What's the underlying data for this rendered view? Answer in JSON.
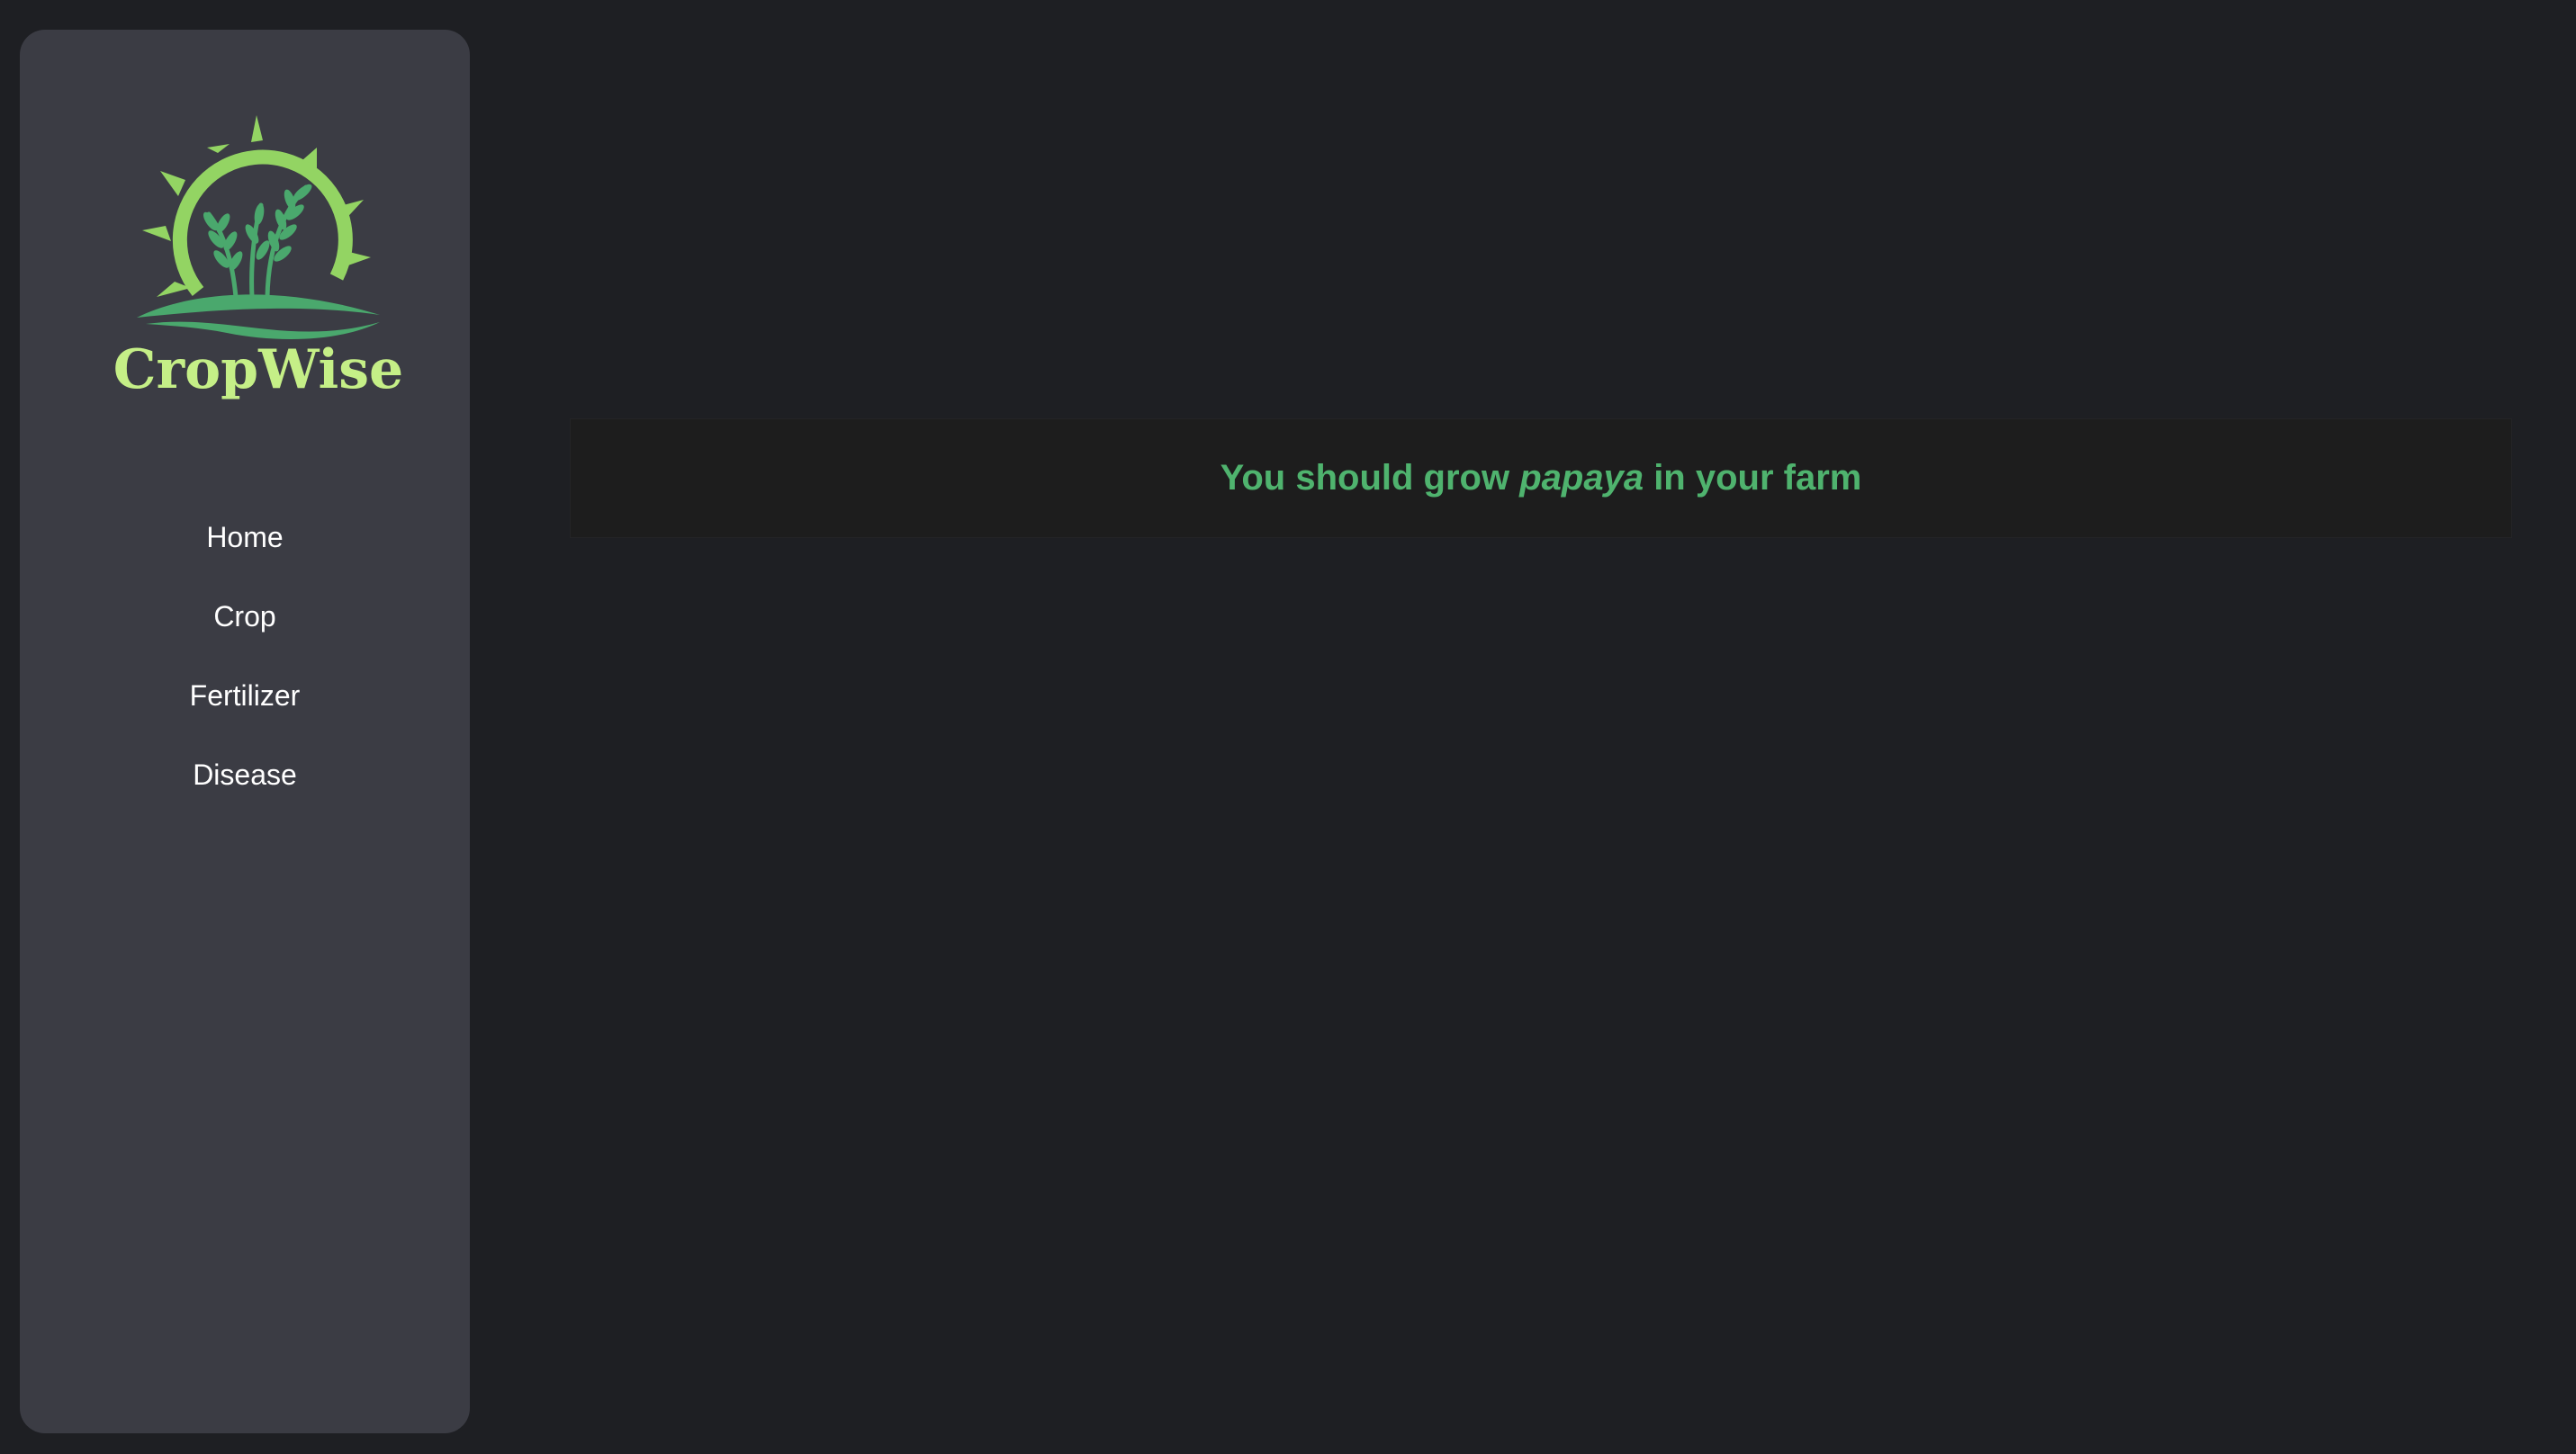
{
  "brand": {
    "name": "CropWise",
    "logo_icon": "sun-wheat-logo-icon",
    "colors": {
      "sun": "#93d463",
      "wheat": "#4aa86d",
      "wordmark": "#c5ef87"
    }
  },
  "sidebar": {
    "items": [
      {
        "label": "Home"
      },
      {
        "label": "Crop"
      },
      {
        "label": "Fertilizer"
      },
      {
        "label": "Disease"
      }
    ]
  },
  "result": {
    "prefix": "You should grow ",
    "crop": "papaya",
    "suffix": " in your farm",
    "color": "#4fb36e"
  },
  "theme": {
    "background": "#1e1f23",
    "sidebar_background": "#3b3c44",
    "panel_background": "#1d1d1d"
  }
}
